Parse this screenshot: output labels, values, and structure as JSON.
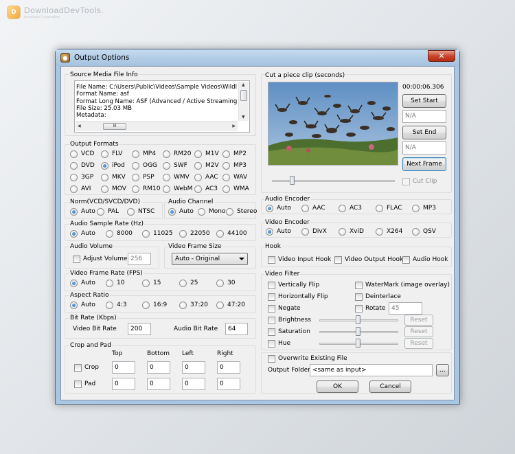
{
  "watermark": {
    "title": "DownloadDevTools.",
    "subtitle": "developer's paradise",
    "logo_glyph": "D"
  },
  "window": {
    "title": "Output Options",
    "close_glyph": "✕"
  },
  "source": {
    "label": "Source Media File Info",
    "lines": [
      "File Name: C:\\Users\\Public\\Videos\\Sample Videos\\Wildlife",
      "Format Name: asf",
      "Format Long Name: ASF (Advanced / Active Streaming F",
      "File Size: 25.03 MB",
      "Metadata:"
    ]
  },
  "output_formats": {
    "label": "Output Formats",
    "selected": "iPod",
    "rows": [
      [
        "VCD",
        "FLV",
        "MP4",
        "RM20",
        "M1V",
        "MP2"
      ],
      [
        "DVD",
        "iPod",
        "OGG",
        "SWF",
        "M2V",
        "MP3"
      ],
      [
        "3GP",
        "MKV",
        "PSP",
        "WMV",
        "AAC",
        "WAV"
      ],
      [
        "AVI",
        "MOV",
        "RM10",
        "WebM",
        "AC3",
        "WMA"
      ]
    ]
  },
  "norm": {
    "label": "Norm(VCD/SVCD/DVD)",
    "options": [
      "Auto",
      "PAL",
      "NTSC"
    ],
    "selected": "Auto"
  },
  "audio_channel": {
    "label": "Audio Channel",
    "options": [
      "Auto",
      "Mono",
      "Stereo"
    ],
    "selected": "Auto"
  },
  "audio_sample_rate": {
    "label": "Audio Sample Rate (Hz)",
    "options": [
      "Auto",
      "8000",
      "11025",
      "22050",
      "44100"
    ],
    "selected": "Auto"
  },
  "audio_volume": {
    "label": "Audio Volume",
    "checkbox_label": "Adjust Volume",
    "value": "256"
  },
  "video_frame_size": {
    "label": "Video Frame Size",
    "value": "Auto - Original"
  },
  "video_frame_rate": {
    "label": "Video Frame Rate (FPS)",
    "options": [
      "Auto",
      "10",
      "15",
      "25",
      "30"
    ],
    "selected": "Auto"
  },
  "aspect_ratio": {
    "label": "Aspect Ratio",
    "options": [
      "Auto",
      "4:3",
      "16:9",
      "37:20",
      "47:20"
    ],
    "selected": "Auto"
  },
  "bit_rate": {
    "label": "Bit Rate (Kbps)",
    "video_label": "Video Bit Rate",
    "video_value": "200",
    "audio_label": "Audio Bit Rate",
    "audio_value": "64"
  },
  "crop_pad": {
    "label": "Crop and Pad",
    "columns": [
      "Top",
      "Bottom",
      "Left",
      "Right"
    ],
    "crop_label": "Crop",
    "pad_label": "Pad",
    "crop_values": [
      "0",
      "0",
      "0",
      "0"
    ],
    "pad_values": [
      "0",
      "0",
      "0",
      "0"
    ]
  },
  "clip": {
    "label": "Cut a piece clip (seconds)",
    "time": "00:00:06.306",
    "set_start_label": "Set Start",
    "start_value": "N/A",
    "set_end_label": "Set End",
    "end_value": "N/A",
    "next_frame_label": "Next Frame",
    "cut_clip_label": "Cut Clip",
    "seek_position": 0.15
  },
  "audio_encoder": {
    "label": "Audio Encoder",
    "options": [
      "Auto",
      "AAC",
      "AC3",
      "FLAC",
      "MP3"
    ],
    "selected": "Auto"
  },
  "video_encoder": {
    "label": "Video Encoder",
    "options": [
      "Auto",
      "DivX",
      "XviD",
      "X264",
      "QSV"
    ],
    "selected": "Auto"
  },
  "hook": {
    "label": "Hook",
    "video_input": "Video Input Hook",
    "video_output": "Video Output Hook",
    "audio": "Audio Hook"
  },
  "video_filter": {
    "label": "Video Filter",
    "vertically_flip": "Vertically Flip",
    "horizontally_flip": "Horizontally Flip",
    "negate": "Negate",
    "watermark": "WaterMark (image overlay)",
    "deinterlace": "Deinterlace",
    "rotate": "Rotate",
    "rotate_value": "45",
    "reset_label": "Reset",
    "sliders": [
      {
        "label": "Brightness",
        "level": 0.5
      },
      {
        "label": "Saturation",
        "level": 0.5
      },
      {
        "label": "Hue",
        "level": 0.5
      }
    ]
  },
  "overwrite_label": "Overwrite Existing File",
  "output_folder": {
    "label": "Output Folder",
    "value": "<same as input>",
    "browse_label": "..."
  },
  "ok_label": "OK",
  "cancel_label": "Cancel",
  "colors": {
    "title_bar": "#a9c6e3",
    "dialog_bg": "#f0f0f0",
    "close_button": "#c9462c",
    "radio_selected": "#1d5fa6"
  }
}
